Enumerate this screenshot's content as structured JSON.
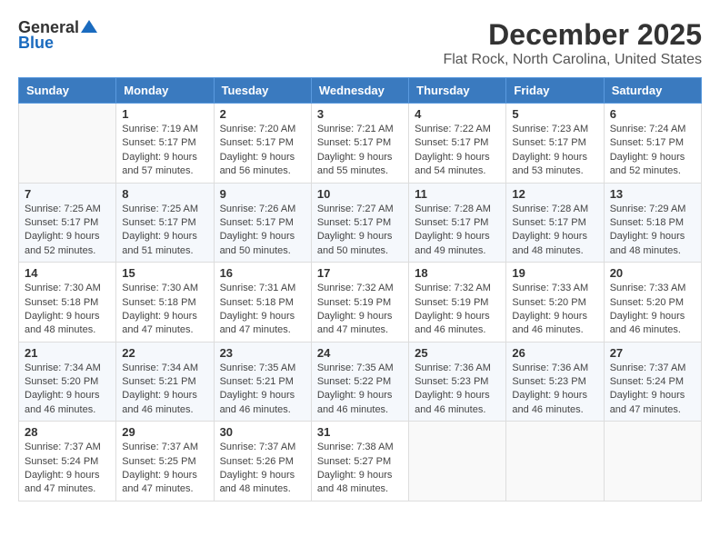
{
  "logo": {
    "general": "General",
    "blue": "Blue"
  },
  "title": {
    "month": "December 2025",
    "location": "Flat Rock, North Carolina, United States"
  },
  "weekdays": [
    "Sunday",
    "Monday",
    "Tuesday",
    "Wednesday",
    "Thursday",
    "Friday",
    "Saturday"
  ],
  "weeks": [
    [
      {
        "day": "",
        "info": ""
      },
      {
        "day": "1",
        "info": "Sunrise: 7:19 AM\nSunset: 5:17 PM\nDaylight: 9 hours\nand 57 minutes."
      },
      {
        "day": "2",
        "info": "Sunrise: 7:20 AM\nSunset: 5:17 PM\nDaylight: 9 hours\nand 56 minutes."
      },
      {
        "day": "3",
        "info": "Sunrise: 7:21 AM\nSunset: 5:17 PM\nDaylight: 9 hours\nand 55 minutes."
      },
      {
        "day": "4",
        "info": "Sunrise: 7:22 AM\nSunset: 5:17 PM\nDaylight: 9 hours\nand 54 minutes."
      },
      {
        "day": "5",
        "info": "Sunrise: 7:23 AM\nSunset: 5:17 PM\nDaylight: 9 hours\nand 53 minutes."
      },
      {
        "day": "6",
        "info": "Sunrise: 7:24 AM\nSunset: 5:17 PM\nDaylight: 9 hours\nand 52 minutes."
      }
    ],
    [
      {
        "day": "7",
        "info": "Sunrise: 7:25 AM\nSunset: 5:17 PM\nDaylight: 9 hours\nand 52 minutes."
      },
      {
        "day": "8",
        "info": "Sunrise: 7:25 AM\nSunset: 5:17 PM\nDaylight: 9 hours\nand 51 minutes."
      },
      {
        "day": "9",
        "info": "Sunrise: 7:26 AM\nSunset: 5:17 PM\nDaylight: 9 hours\nand 50 minutes."
      },
      {
        "day": "10",
        "info": "Sunrise: 7:27 AM\nSunset: 5:17 PM\nDaylight: 9 hours\nand 50 minutes."
      },
      {
        "day": "11",
        "info": "Sunrise: 7:28 AM\nSunset: 5:17 PM\nDaylight: 9 hours\nand 49 minutes."
      },
      {
        "day": "12",
        "info": "Sunrise: 7:28 AM\nSunset: 5:17 PM\nDaylight: 9 hours\nand 48 minutes."
      },
      {
        "day": "13",
        "info": "Sunrise: 7:29 AM\nSunset: 5:18 PM\nDaylight: 9 hours\nand 48 minutes."
      }
    ],
    [
      {
        "day": "14",
        "info": "Sunrise: 7:30 AM\nSunset: 5:18 PM\nDaylight: 9 hours\nand 48 minutes."
      },
      {
        "day": "15",
        "info": "Sunrise: 7:30 AM\nSunset: 5:18 PM\nDaylight: 9 hours\nand 47 minutes."
      },
      {
        "day": "16",
        "info": "Sunrise: 7:31 AM\nSunset: 5:18 PM\nDaylight: 9 hours\nand 47 minutes."
      },
      {
        "day": "17",
        "info": "Sunrise: 7:32 AM\nSunset: 5:19 PM\nDaylight: 9 hours\nand 47 minutes."
      },
      {
        "day": "18",
        "info": "Sunrise: 7:32 AM\nSunset: 5:19 PM\nDaylight: 9 hours\nand 46 minutes."
      },
      {
        "day": "19",
        "info": "Sunrise: 7:33 AM\nSunset: 5:20 PM\nDaylight: 9 hours\nand 46 minutes."
      },
      {
        "day": "20",
        "info": "Sunrise: 7:33 AM\nSunset: 5:20 PM\nDaylight: 9 hours\nand 46 minutes."
      }
    ],
    [
      {
        "day": "21",
        "info": "Sunrise: 7:34 AM\nSunset: 5:20 PM\nDaylight: 9 hours\nand 46 minutes."
      },
      {
        "day": "22",
        "info": "Sunrise: 7:34 AM\nSunset: 5:21 PM\nDaylight: 9 hours\nand 46 minutes."
      },
      {
        "day": "23",
        "info": "Sunrise: 7:35 AM\nSunset: 5:21 PM\nDaylight: 9 hours\nand 46 minutes."
      },
      {
        "day": "24",
        "info": "Sunrise: 7:35 AM\nSunset: 5:22 PM\nDaylight: 9 hours\nand 46 minutes."
      },
      {
        "day": "25",
        "info": "Sunrise: 7:36 AM\nSunset: 5:23 PM\nDaylight: 9 hours\nand 46 minutes."
      },
      {
        "day": "26",
        "info": "Sunrise: 7:36 AM\nSunset: 5:23 PM\nDaylight: 9 hours\nand 46 minutes."
      },
      {
        "day": "27",
        "info": "Sunrise: 7:37 AM\nSunset: 5:24 PM\nDaylight: 9 hours\nand 47 minutes."
      }
    ],
    [
      {
        "day": "28",
        "info": "Sunrise: 7:37 AM\nSunset: 5:24 PM\nDaylight: 9 hours\nand 47 minutes."
      },
      {
        "day": "29",
        "info": "Sunrise: 7:37 AM\nSunset: 5:25 PM\nDaylight: 9 hours\nand 47 minutes."
      },
      {
        "day": "30",
        "info": "Sunrise: 7:37 AM\nSunset: 5:26 PM\nDaylight: 9 hours\nand 48 minutes."
      },
      {
        "day": "31",
        "info": "Sunrise: 7:38 AM\nSunset: 5:27 PM\nDaylight: 9 hours\nand 48 minutes."
      },
      {
        "day": "",
        "info": ""
      },
      {
        "day": "",
        "info": ""
      },
      {
        "day": "",
        "info": ""
      }
    ]
  ]
}
